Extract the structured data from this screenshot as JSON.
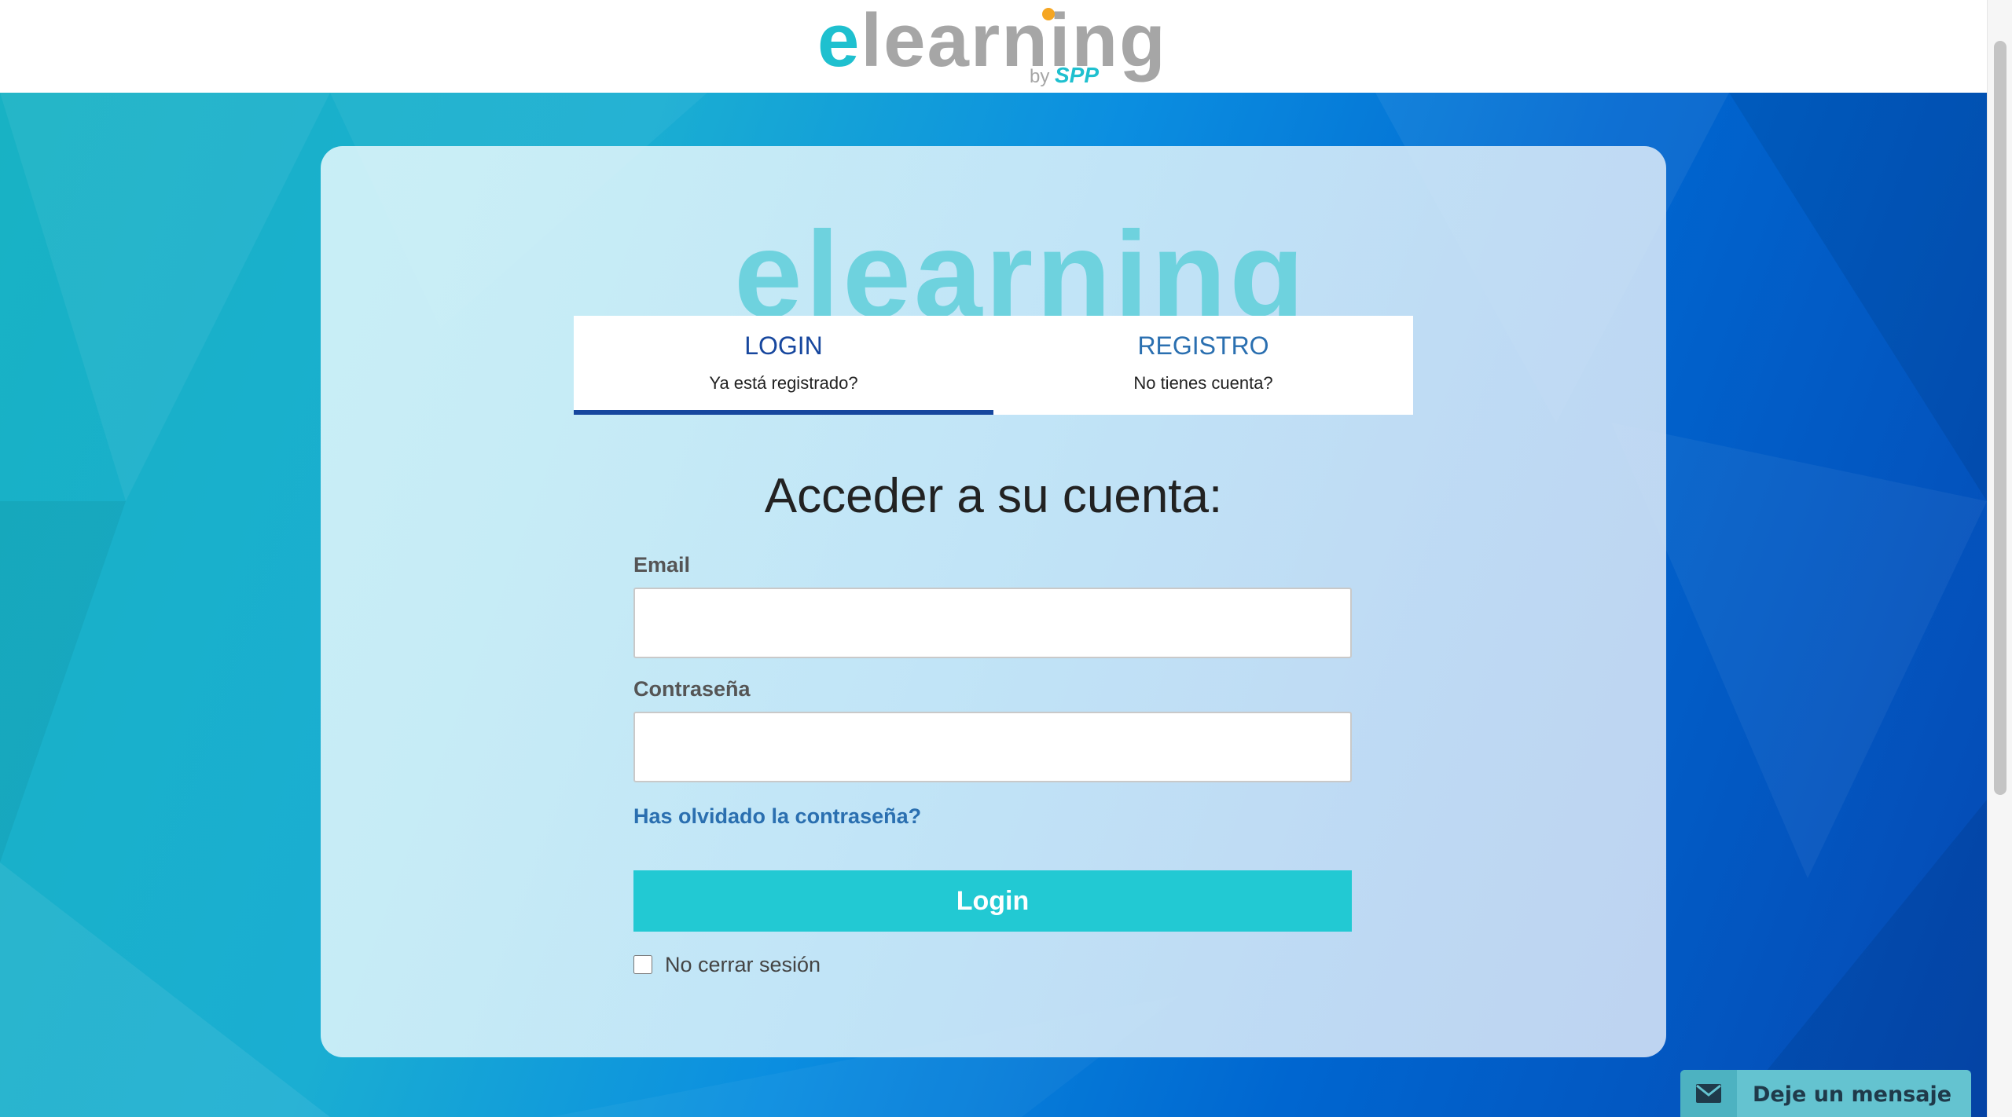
{
  "header": {
    "logo": {
      "e": "e",
      "rest": "learning",
      "by": "by",
      "brand": "SPP"
    }
  },
  "card": {
    "logo_text": "elearning",
    "tabs": [
      {
        "title": "LOGIN",
        "subtitle": "Ya está registrado?",
        "active": true
      },
      {
        "title": "REGISTRO",
        "subtitle": "No tienes cuenta?",
        "active": false
      }
    ],
    "form": {
      "title": "Acceder a su cuenta:",
      "email_label": "Email",
      "email_value": "",
      "password_label": "Contraseña",
      "password_value": "",
      "forgot_link": "Has olvidado la contraseña?",
      "login_button": "Login",
      "remember_label": "No cerrar sesión",
      "remember_checked": false
    }
  },
  "chat_widget": {
    "label": "Deje un mensaje",
    "icon": "envelope-icon"
  },
  "colors": {
    "accent": "#22c9d3",
    "tab_active": "#17479e",
    "link": "#2a6fb0",
    "logo_e": "#1fc0cf",
    "logo_text": "#a6a6a6",
    "logo_dot": "#f5a623"
  }
}
